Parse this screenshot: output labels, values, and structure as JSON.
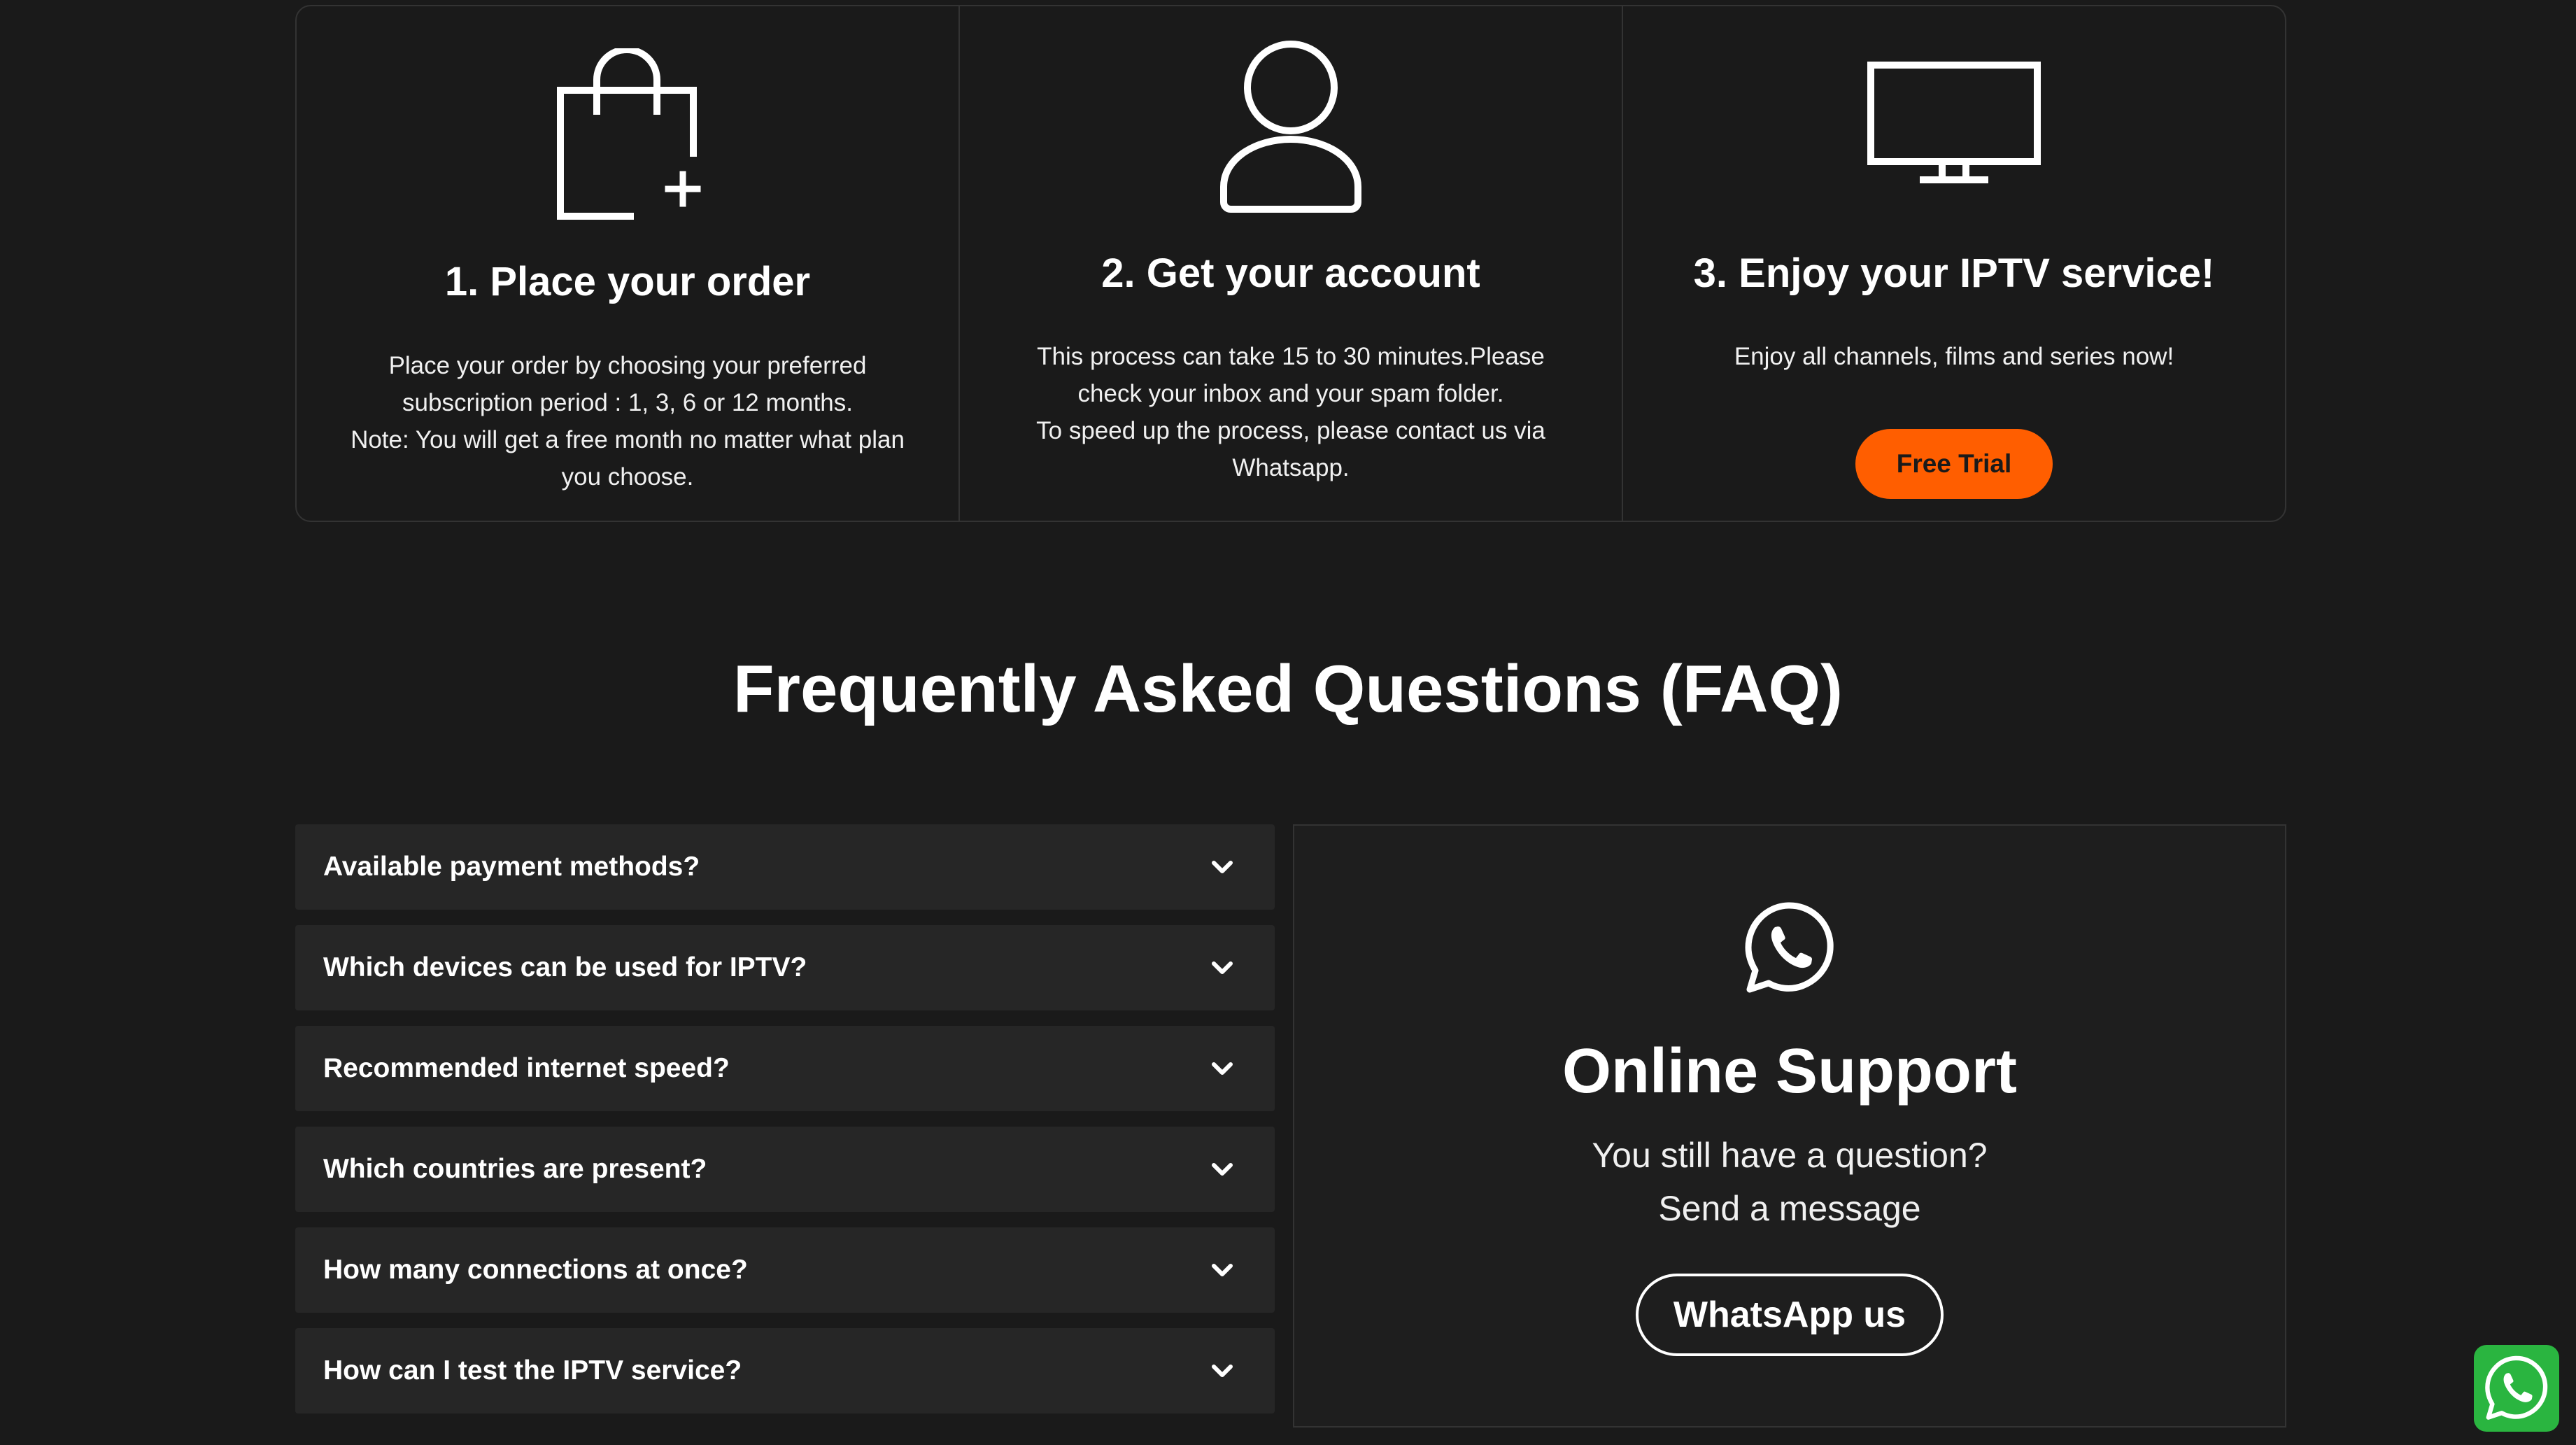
{
  "steps": [
    {
      "title": "1. Place your order",
      "icon": "shopping-bag-plus-icon",
      "desc": [
        "Place your order by choosing your preferred",
        "subscription period : 1, 3, 6 or 12 months.",
        "Note: You will get a free month no matter what plan",
        "you choose."
      ]
    },
    {
      "title": "2. Get your account",
      "icon": "user-icon",
      "desc": [
        "This process can take 15 to 30 minutes.Please",
        "check your inbox and your spam folder.",
        "To speed up the process, please contact us via",
        "Whatsapp."
      ]
    },
    {
      "title": "3. Enjoy your IPTV service!",
      "icon": "tv-icon",
      "desc": [
        "Enjoy all channels, films and series now!"
      ],
      "button": "Free Trial"
    }
  ],
  "faq": {
    "title": "Frequently Asked Questions (FAQ)",
    "items": [
      "Available payment methods?",
      "Which devices can be used for IPTV?",
      "Recommended internet speed?",
      "Which countries are present?",
      "How many connections at once?",
      "How can I test the IPTV service?"
    ]
  },
  "support": {
    "icon": "whatsapp-icon",
    "title": "Online Support",
    "line1": "You still have a question?",
    "line2": "Send a message",
    "button": "WhatsApp us"
  },
  "floating_button": {
    "icon": "whatsapp-icon"
  },
  "colors": {
    "background": "#1a1a1a",
    "accent": "#ff5e00",
    "whatsapp_green": "#2ab540"
  }
}
